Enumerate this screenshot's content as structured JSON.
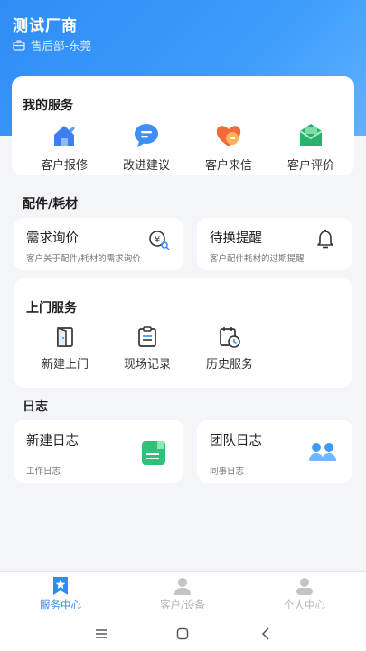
{
  "header": {
    "company": "测试厂商",
    "department": "售后部-东莞"
  },
  "my_services": {
    "title": "我的服务",
    "items": [
      {
        "label": "客户报修",
        "icon": "repair-house-icon"
      },
      {
        "label": "改进建议",
        "icon": "suggestion-bubble-icon"
      },
      {
        "label": "客户来信",
        "icon": "heart-letter-icon"
      },
      {
        "label": "客户评价",
        "icon": "envelope-review-icon"
      }
    ]
  },
  "parts": {
    "title": "配件/耗材",
    "inquiry": {
      "title": "需求询价",
      "desc": "客户关于配件/耗材的需求询价",
      "icon": "yen-search-icon"
    },
    "reminder": {
      "title": "待换提醒",
      "desc": "客户配件耗材的过期提醒",
      "icon": "bell-icon"
    }
  },
  "visit": {
    "title": "上门服务",
    "items": [
      {
        "label": "新建上门",
        "icon": "door-icon"
      },
      {
        "label": "现场记录",
        "icon": "clipboard-icon"
      },
      {
        "label": "历史服务",
        "icon": "history-calendar-icon"
      }
    ]
  },
  "log": {
    "title": "日志",
    "new": {
      "title": "新建日志",
      "desc": "工作日志",
      "icon": "notebook-icon"
    },
    "team": {
      "title": "团队日志",
      "desc": "同事日志",
      "icon": "team-icon"
    }
  },
  "tabs": [
    {
      "label": "服务中心",
      "active": true
    },
    {
      "label": "客户/设备",
      "active": false
    },
    {
      "label": "个人中心",
      "active": false
    }
  ],
  "colors": {
    "primary": "#2f8cf6",
    "inactive": "#b5b5b5"
  }
}
